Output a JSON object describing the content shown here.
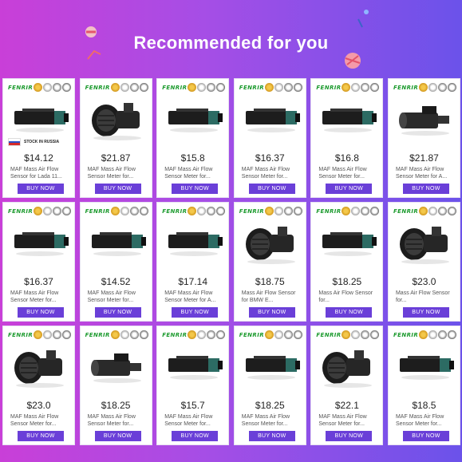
{
  "header": {
    "title": "Recommended for you"
  },
  "colors": {
    "background_start": "#c93fd8",
    "background_end": "#6b52ea",
    "button": "#6a3fd8",
    "brand": "#1b9a2d"
  },
  "products": [
    {
      "brand": "FENRIR",
      "price": "$14.12",
      "title": "MAF Mass Air Flow Sensor for Lada 11...",
      "button": "BUY NOW",
      "stock": "STOCK IN RUSSIA",
      "shape": "slim"
    },
    {
      "brand": "FENRIR",
      "price": "$21.87",
      "title": "MAF Mass Air Flow Sensor Meter for...",
      "button": "BUY NOW",
      "shape": "tube"
    },
    {
      "brand": "FENRIR",
      "price": "$15.8",
      "title": "MAF Mass Air Flow Sensor Meter for...",
      "button": "BUY NOW",
      "shape": "slim"
    },
    {
      "brand": "FENRIR",
      "price": "$16.37",
      "title": "MAF Mass Air Flow Sensor Meter for...",
      "button": "BUY NOW",
      "shape": "slim"
    },
    {
      "brand": "FENRIR",
      "price": "$16.8",
      "title": "MAF Mass Air Flow Sensor Meter for...",
      "button": "BUY NOW",
      "shape": "slim"
    },
    {
      "brand": "FENRIR",
      "price": "$21.87",
      "title": "MAF Mass Air Flow Sensor Meter for A...",
      "button": "BUY NOW",
      "shape": "cylinder"
    },
    {
      "brand": "FENRIR",
      "price": "$16.37",
      "title": "MAF Mass Air Flow Sensor Meter for...",
      "button": "BUY NOW",
      "shape": "slim"
    },
    {
      "brand": "FENRIR",
      "price": "$14.52",
      "title": "MAF Mass Air Flow Sensor Meter for...",
      "button": "BUY NOW",
      "shape": "slim"
    },
    {
      "brand": "FENRIR",
      "price": "$17.14",
      "title": "MAF Mass Air Flow Sensor Meter for A...",
      "button": "BUY NOW",
      "shape": "slim"
    },
    {
      "brand": "FENRIR",
      "price": "$18.75",
      "title": "Mass Air Flow Sensor for BMW E...",
      "button": "BUY NOW",
      "shape": "tube"
    },
    {
      "brand": "FENRIR",
      "price": "$18.25",
      "title": "Mass Air Flow Sensor for...",
      "button": "BUY NOW",
      "shape": "slim"
    },
    {
      "brand": "FENRIR",
      "price": "$23.0",
      "title": "Mass Air Flow Sensor for...",
      "button": "BUY NOW",
      "shape": "tube"
    },
    {
      "brand": "FENRIR",
      "price": "$23.0",
      "title": "MAF Mass Air Flow Sensor Meter for...",
      "button": "BUY NOW",
      "shape": "tube"
    },
    {
      "brand": "FENRIR",
      "price": "$18.25",
      "title": "MAF Mass Air Flow Sensor Meter for...",
      "button": "BUY NOW",
      "shape": "cylinder"
    },
    {
      "brand": "FENRIR",
      "price": "$15.7",
      "title": "MAF Mass Air Flow Sensor Meter for...",
      "button": "BUY NOW",
      "shape": "slim"
    },
    {
      "brand": "FENRIR",
      "price": "$18.25",
      "title": "MAF Mass Air Flow Sensor Meter for...",
      "button": "BUY NOW",
      "shape": "slim"
    },
    {
      "brand": "FENRIR",
      "price": "$22.1",
      "title": "MAF Mass Air Flow Sensor Meter for...",
      "button": "BUY NOW",
      "shape": "tube"
    },
    {
      "brand": "FENRIR",
      "price": "$18.5",
      "title": "MAF Mass Air Flow Sensor Meter for...",
      "button": "BUY NOW",
      "shape": "slim"
    }
  ]
}
